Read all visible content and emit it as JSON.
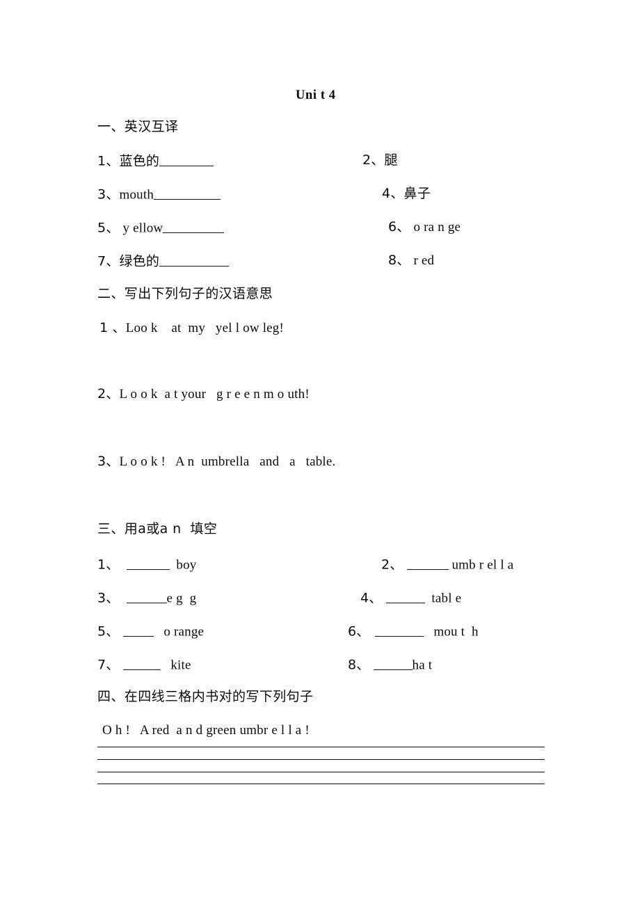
{
  "document": {
    "title": "Uni t 4"
  },
  "sections": [
    {
      "heading": "一、英汉互译",
      "items": [
        {
          "num": "1、",
          "text": "蓝色的",
          "blank_after": true,
          "blank_width": 78
        },
        {
          "num": "2、",
          "text": "腿",
          "blank_after": false,
          "blank_width": 0
        },
        {
          "num": "3、",
          "text": "mouth",
          "blank_after": true,
          "blank_width": 96
        },
        {
          "num": "4、",
          "text": "鼻子",
          "blank_after": false,
          "blank_width": 0
        },
        {
          "num": "5、",
          "text": " y ellow",
          "blank_after": true,
          "blank_width": 88
        },
        {
          "num": "6、",
          "text": " o ra n ge",
          "blank_after": false,
          "blank_width": 0
        },
        {
          "num": "7、",
          "text": "绿色的",
          "blank_after": true,
          "blank_width": 100
        },
        {
          "num": "8、",
          "text": " r ed",
          "blank_after": false,
          "blank_width": 0
        }
      ]
    },
    {
      "heading": "二、写出下列句子的汉语意思",
      "sentences": [
        {
          "num": "1 、",
          "text": "Loo k    at  my   yel l ow leg!"
        },
        {
          "num": "2、",
          "text": "L o o k  a t your   g r e e n m o uth!"
        },
        {
          "num": "3、",
          "text": "L o o k !   A n  umbrella   and   a   table."
        }
      ]
    },
    {
      "heading": "三、用a或a n  填空",
      "items": [
        {
          "num": "1、",
          "blank_width": 62,
          "text": "  boy"
        },
        {
          "num": "2、",
          "blank_width": 60,
          "text": " umb r el l a"
        },
        {
          "num": "3、",
          "blank_width": 58,
          "text": "e g  g"
        },
        {
          "num": "4、",
          "blank_width": 56,
          "text": "  tabl e"
        },
        {
          "num": "5、",
          "blank_width": 44,
          "text": "   o range"
        },
        {
          "num": "6、",
          "blank_width": 70,
          "text": "   mou t  h"
        },
        {
          "num": "7、",
          "blank_width": 54,
          "text": "   kite"
        },
        {
          "num": "8、",
          "blank_width": 56,
          "text": "ha t"
        }
      ]
    },
    {
      "heading": "四、在四线三格内书对的写下列句子",
      "sentence": "O h !   A red  a n d green umbr e l l a !",
      "guide_lines": 4
    }
  ]
}
